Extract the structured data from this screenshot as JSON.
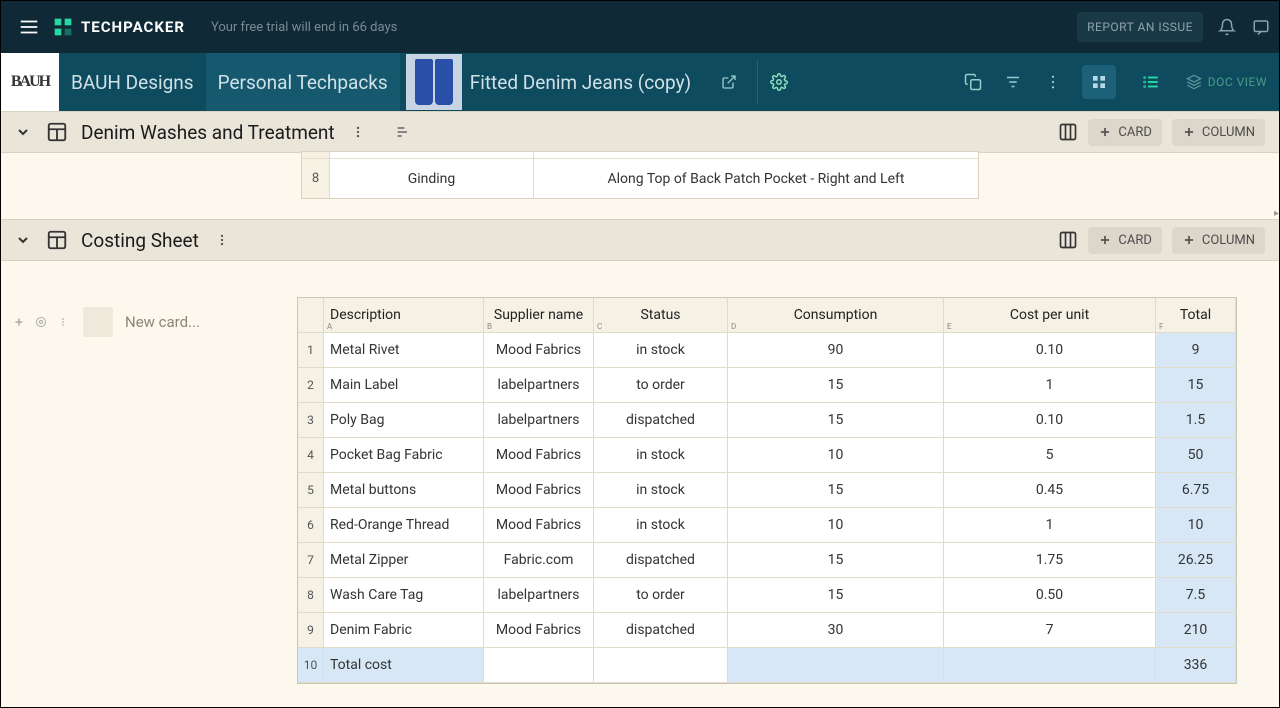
{
  "topbar": {
    "brand": "TECHPACKER",
    "trial_text": "Your free trial will end in 66 days",
    "report_button": "REPORT AN ISSUE"
  },
  "breadcrumb": {
    "brand_box": "BAUH",
    "item1": "BAUH Designs",
    "item2": "Personal Techpacks",
    "item3": "Fitted Denim Jeans (copy)",
    "docview": "DOC VIEW"
  },
  "section1": {
    "title": "Denim Washes and Treatment",
    "card_btn": "CARD",
    "column_btn": "COLUMN",
    "row_num": "8",
    "row_c1": "Ginding",
    "row_c2": "Along Top of Back Patch Pocket - Right and Left"
  },
  "section2": {
    "title": "Costing Sheet",
    "card_btn": "CARD",
    "column_btn": "COLUMN",
    "newcard_placeholder": "New card..."
  },
  "costing": {
    "headers": {
      "a": "Description",
      "b": "Supplier name",
      "c": "Status",
      "d": "Consumption",
      "e": "Cost per unit",
      "f": "Total"
    },
    "rows": [
      {
        "n": "1",
        "a": "Metal Rivet",
        "b": "Mood Fabrics",
        "c": "in stock",
        "d": "90",
        "e": "0.10",
        "f": "9"
      },
      {
        "n": "2",
        "a": "Main Label",
        "b": "labelpartners",
        "c": "to order",
        "d": "15",
        "e": "1",
        "f": "15"
      },
      {
        "n": "3",
        "a": "Poly Bag",
        "b": "labelpartners",
        "c": "dispatched",
        "d": "15",
        "e": "0.10",
        "f": "1.5"
      },
      {
        "n": "4",
        "a": "Pocket Bag Fabric",
        "b": "Mood Fabrics",
        "c": "in stock",
        "d": "10",
        "e": "5",
        "f": "50"
      },
      {
        "n": "5",
        "a": "Metal buttons",
        "b": "Mood Fabrics",
        "c": "in stock",
        "d": "15",
        "e": "0.45",
        "f": "6.75"
      },
      {
        "n": "6",
        "a": "Red-Orange Thread",
        "b": "Mood Fabrics",
        "c": "in stock",
        "d": "10",
        "e": "1",
        "f": "10"
      },
      {
        "n": "7",
        "a": "Metal Zipper",
        "b": "Fabric.com",
        "c": "dispatched",
        "d": "15",
        "e": "1.75",
        "f": "26.25"
      },
      {
        "n": "8",
        "a": "Wash Care Tag",
        "b": "labelpartners",
        "c": "to order",
        "d": "15",
        "e": "0.50",
        "f": "7.5"
      },
      {
        "n": "9",
        "a": "Denim Fabric",
        "b": "Mood Fabrics",
        "c": "dispatched",
        "d": "30",
        "e": "7",
        "f": "210"
      }
    ],
    "total_row": {
      "n": "10",
      "a": "Total cost",
      "b": "",
      "c": "",
      "d": "",
      "e": "",
      "f": "336"
    }
  }
}
